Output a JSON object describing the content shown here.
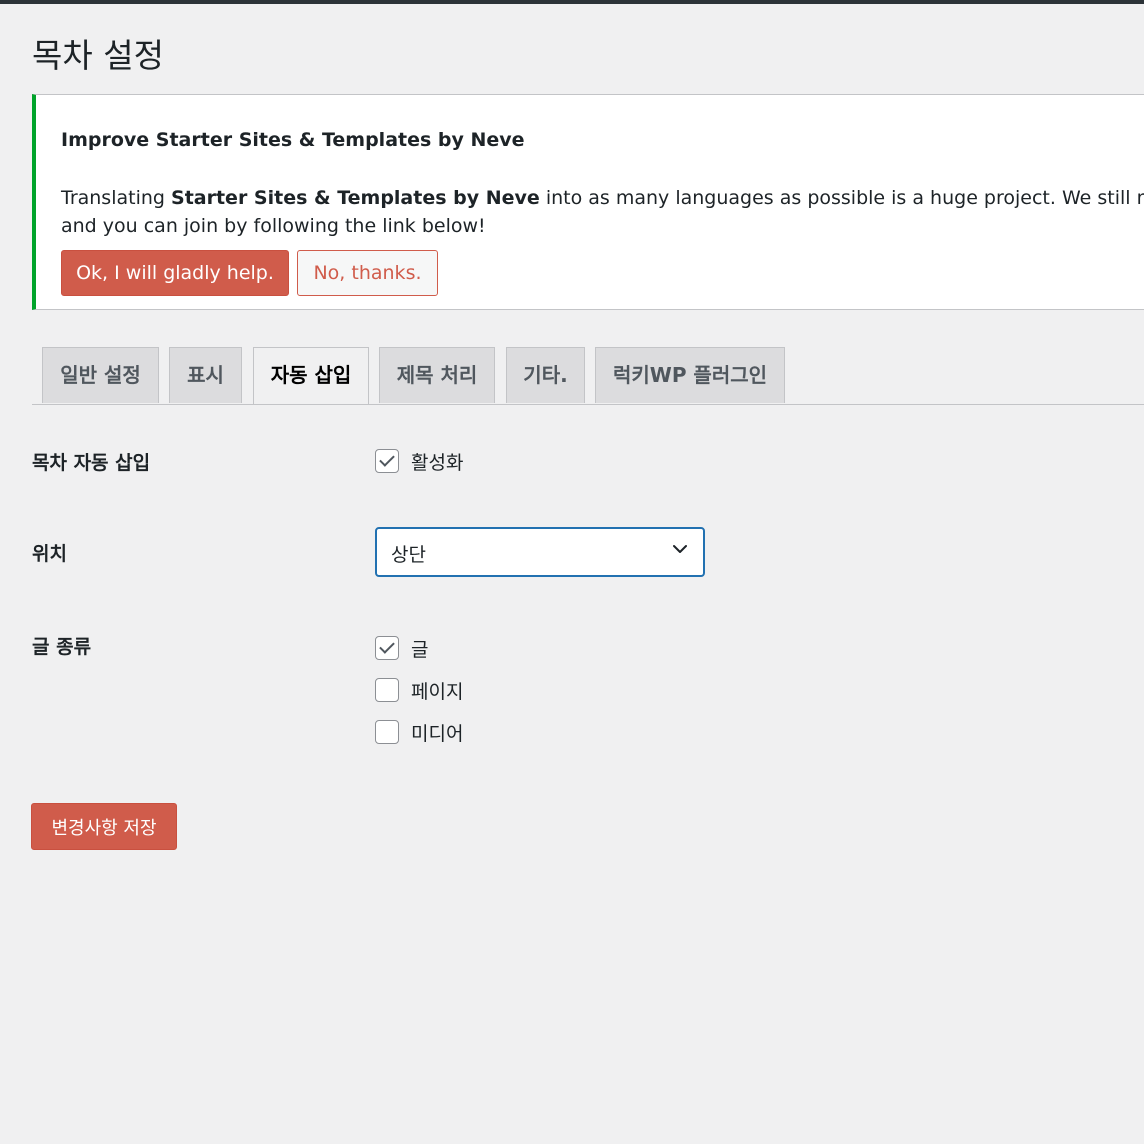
{
  "page": {
    "title": "목차 설정"
  },
  "notice": {
    "title": "Improve Starter Sites & Templates by Neve",
    "text_prefix": "Translating ",
    "text_bold": "Starter Sites & Templates by Neve",
    "text_suffix": " into as many languages as possible is a huge project. We still need",
    "text_line2": "and you can join by following the link below!",
    "help_button": "Ok, I will gladly help.",
    "decline_button": "No, thanks."
  },
  "tabs": [
    {
      "label": "일반 설정",
      "active": false
    },
    {
      "label": "표시",
      "active": false
    },
    {
      "label": "자동 삽입",
      "active": true
    },
    {
      "label": "제목 처리",
      "active": false
    },
    {
      "label": "기타.",
      "active": false
    },
    {
      "label": "럭키WP 플러그인",
      "active": false
    }
  ],
  "form": {
    "auto_insert": {
      "label": "목차 자동 삽입",
      "option_label": "활성화",
      "checked": true
    },
    "position": {
      "label": "위치",
      "value": "상단"
    },
    "post_types": {
      "label": "글 종류",
      "options": [
        {
          "label": "글",
          "checked": true
        },
        {
          "label": "페이지",
          "checked": false
        },
        {
          "label": "미디어",
          "checked": false
        }
      ]
    },
    "save_button": "변경사항 저장"
  },
  "colors": {
    "accent_button": "#d05c4b",
    "notice_border": "#00a32a",
    "focus_border": "#2271b1",
    "background": "#f0f0f1"
  },
  "icons": {
    "select_arrow": "chevron-down-icon",
    "checkmark": "checkmark-icon"
  }
}
